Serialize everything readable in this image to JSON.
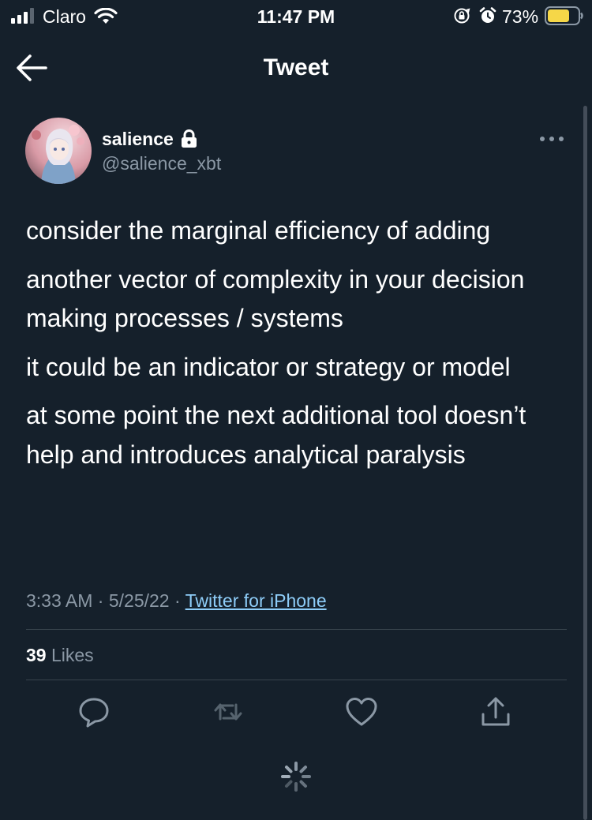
{
  "status_bar": {
    "carrier": "Claro",
    "time": "11:47 PM",
    "battery_percent": "73%",
    "battery_level": 0.73,
    "battery_color": "#f6d748"
  },
  "header": {
    "title": "Tweet"
  },
  "tweet": {
    "author": {
      "display_name": "salience",
      "handle": "@salience_xbt",
      "protected": true
    },
    "paragraphs": [
      "consider the marginal efficiency of adding",
      "another vector of complexity in your decision making processes / systems",
      "it could be an indicator or strategy or model",
      "at some point the next additional tool doesn’t help and introduces analytical paralysis"
    ],
    "time": "3:33 AM",
    "date": "5/25/22",
    "separator": "·",
    "source": "Twitter for iPhone",
    "likes_count": "39",
    "likes_label": "Likes"
  },
  "icons": {
    "back": "arrow-left-icon",
    "more": "more-horizontal-icon",
    "lock": "lock-icon",
    "reply": "reply-icon",
    "retweet": "retweet-icon",
    "like": "heart-icon",
    "share": "share-icon",
    "loading": "spinner-icon"
  },
  "colors": {
    "background": "#15202b",
    "secondary_text": "#8b98a5",
    "link": "#8ecdf8",
    "divider": "#38444d"
  }
}
